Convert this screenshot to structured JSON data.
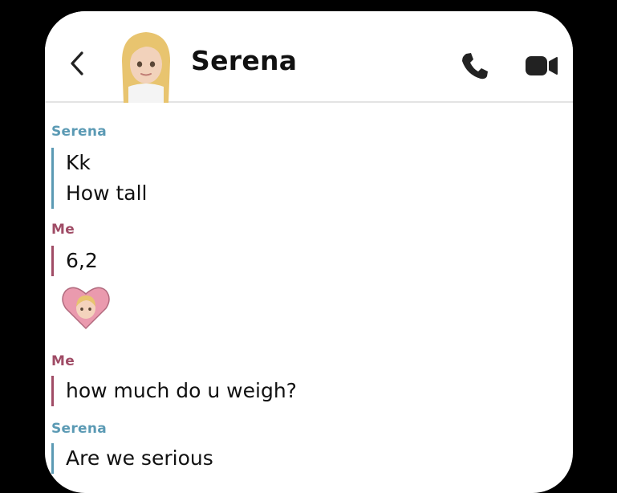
{
  "header": {
    "contact_name": "Serena"
  },
  "icons": {
    "back": "chevron-left-icon",
    "avatar": "bitmoji-avatar",
    "call": "phone-icon",
    "video": "video-camera-icon",
    "heart": "heart-bitmoji-sticker"
  },
  "colors": {
    "them": "#5b9ab4",
    "me": "#a04c66"
  },
  "messages": [
    {
      "sender": "Serena",
      "lines": [
        "Kk",
        "How tall"
      ]
    },
    {
      "sender": "Me",
      "lines": [
        "6,2"
      ]
    },
    {
      "sender": "Me",
      "lines": [
        "how much do u weigh?"
      ]
    },
    {
      "sender": "Serena",
      "lines": [
        "Are we serious"
      ]
    }
  ]
}
